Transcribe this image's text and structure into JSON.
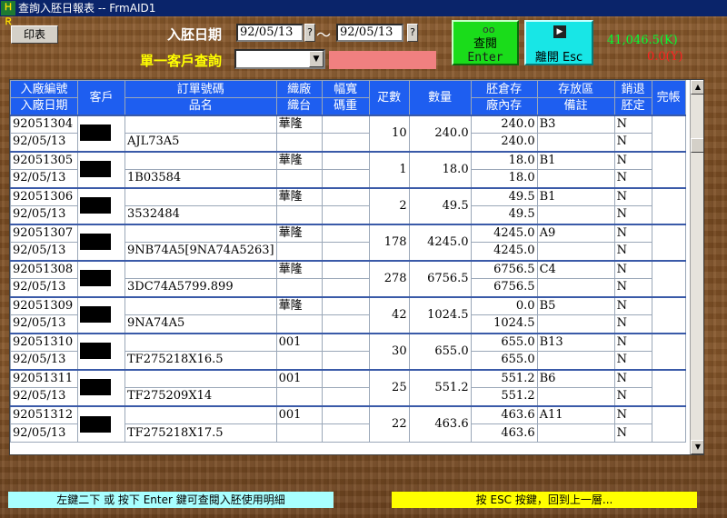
{
  "window": {
    "title": "查詢入胚日報表 -- FrmAID1",
    "icon_text": "ＨＲ"
  },
  "toolbar": {
    "print_label": "印表",
    "date_label": "入胚日期",
    "date_from": "92/05/13",
    "date_to": "92/05/13",
    "date_picker_label": "?",
    "range_sep": "～",
    "customer_query_label": "單一客戶查詢",
    "customer_value": "",
    "customer_name": "",
    "enter_button": {
      "line1": "查閱",
      "line2": "Enter"
    },
    "esc_button": {
      "line1": "離開 Esc"
    }
  },
  "totals": {
    "k_value": "41,046.5(K)",
    "y_value": "0.0(Y)"
  },
  "colors": {
    "header_bg": "#1e5ef0",
    "enter_bg": "#1adc1a",
    "esc_bg": "#18e6e6",
    "total_k": "#00ff33",
    "total_y": "#ff2020"
  },
  "table": {
    "headers": {
      "c1": [
        "入廠編號",
        "入廠日期"
      ],
      "c2": "客戶",
      "c3": [
        "訂單號碼",
        "品名"
      ],
      "c4": [
        "織廠",
        "織台"
      ],
      "c5": [
        "幅寬",
        "碼重"
      ],
      "c6": "疋數",
      "c7": "數量",
      "c8": [
        "胚倉存",
        "廠內存"
      ],
      "c9": [
        "存放區",
        "備註"
      ],
      "c10": [
        "銷退",
        "胚定"
      ],
      "c11": "完帳"
    },
    "rows": [
      {
        "no": "92051304",
        "date": "92/05/13",
        "order": "",
        "product": "AJL73A5",
        "mill": "華隆",
        "loom": "",
        "width": "",
        "weight": "",
        "rolls": "10",
        "qty": "240.0",
        "stock": "240.0",
        "instock": "240.0",
        "area": "B3",
        "note": "",
        "ret": "N",
        "fix": "N"
      },
      {
        "no": "92051305",
        "date": "92/05/13",
        "order": "",
        "product": "1B03584",
        "mill": "華隆",
        "loom": "",
        "width": "",
        "weight": "",
        "rolls": "1",
        "qty": "18.0",
        "stock": "18.0",
        "instock": "18.0",
        "area": "B1",
        "note": "",
        "ret": "N",
        "fix": "N"
      },
      {
        "no": "92051306",
        "date": "92/05/13",
        "order": "",
        "product": "3532484",
        "mill": "華隆",
        "loom": "",
        "width": "",
        "weight": "",
        "rolls": "2",
        "qty": "49.5",
        "stock": "49.5",
        "instock": "49.5",
        "area": "B1",
        "note": "",
        "ret": "N",
        "fix": "N"
      },
      {
        "no": "92051307",
        "date": "92/05/13",
        "order": "",
        "product": "9NB74A5[9NA74A5263]",
        "mill": "華隆",
        "loom": "",
        "width": "",
        "weight": "",
        "rolls": "178",
        "qty": "4245.0",
        "stock": "4245.0",
        "instock": "4245.0",
        "area": "A9",
        "note": "",
        "ret": "N",
        "fix": "N"
      },
      {
        "no": "92051308",
        "date": "92/05/13",
        "order": "",
        "product": "3DC74A5799.899",
        "mill": "華隆",
        "loom": "",
        "width": "",
        "weight": "",
        "rolls": "278",
        "qty": "6756.5",
        "stock": "6756.5",
        "instock": "6756.5",
        "area": "C4",
        "note": "",
        "ret": "N",
        "fix": "N"
      },
      {
        "no": "92051309",
        "date": "92/05/13",
        "order": "",
        "product": "9NA74A5",
        "mill": "華隆",
        "loom": "",
        "width": "",
        "weight": "",
        "rolls": "42",
        "qty": "1024.5",
        "stock": "0.0",
        "instock": "1024.5",
        "area": "B5",
        "note": "",
        "ret": "N",
        "fix": "N"
      },
      {
        "no": "92051310",
        "date": "92/05/13",
        "order": "",
        "product": "TF275218X16.5",
        "mill": "001",
        "loom": "",
        "width": "",
        "weight": "",
        "rolls": "30",
        "qty": "655.0",
        "stock": "655.0",
        "instock": "655.0",
        "area": "B13",
        "note": "",
        "ret": "N",
        "fix": "N"
      },
      {
        "no": "92051311",
        "date": "92/05/13",
        "order": "",
        "product": "TF275209X14",
        "mill": "001",
        "loom": "",
        "width": "",
        "weight": "",
        "rolls": "25",
        "qty": "551.2",
        "stock": "551.2",
        "instock": "551.2",
        "area": "B6",
        "note": "",
        "ret": "N",
        "fix": "N"
      },
      {
        "no": "92051312",
        "date": "92/05/13",
        "order": "",
        "product": "TF275218X17.5",
        "mill": "001",
        "loom": "",
        "width": "",
        "weight": "",
        "rolls": "22",
        "qty": "463.6",
        "stock": "463.6",
        "instock": "463.6",
        "area": "A11",
        "note": "",
        "ret": "N",
        "fix": "N"
      }
    ]
  },
  "footer": {
    "hint_left": "左鍵二下 或 按下 Enter 鍵可查閱入胚使用明細",
    "hint_right": "按 ESC 按鍵，回到上一層..."
  }
}
